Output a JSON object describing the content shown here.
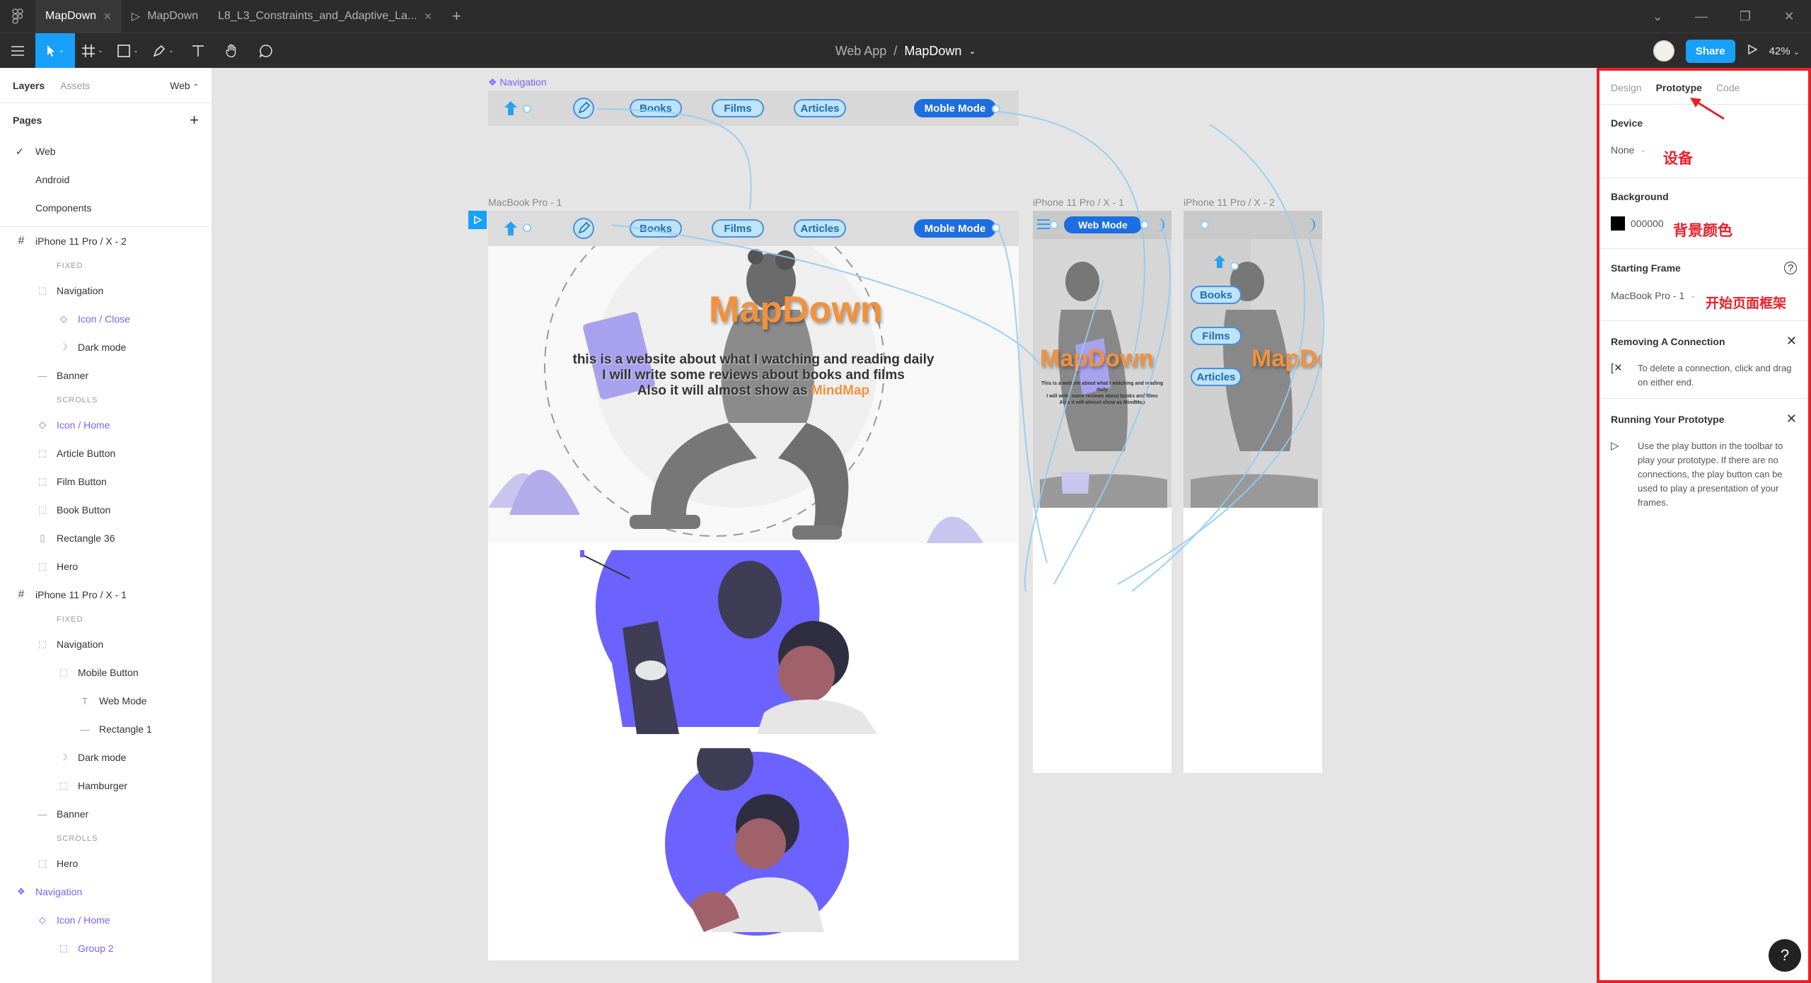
{
  "titlebar": {
    "tabs": [
      {
        "label": "MapDown",
        "active": true,
        "closable": true
      },
      {
        "label": "MapDown",
        "active": false,
        "play": true
      },
      {
        "label": "L8_L3_Constraints_and_Adaptive_La...",
        "active": false
      }
    ]
  },
  "toolbar": {
    "breadcrumb_parent": "Web App",
    "breadcrumb_sep": "/",
    "breadcrumb_current": "MapDown",
    "share_label": "Share",
    "zoom_label": "42%"
  },
  "left_panel": {
    "tab_layers": "Layers",
    "tab_assets": "Assets",
    "page_selector": "Web",
    "pages_heading": "Pages",
    "pages": [
      "Web",
      "Android",
      "Components"
    ],
    "layers": [
      {
        "label": "iPhone 11 Pro / X - 2",
        "kind": "frame",
        "indent": 0
      },
      {
        "label": "FIXED",
        "kind": "section",
        "indent": 1
      },
      {
        "label": "Navigation",
        "kind": "group",
        "indent": 1
      },
      {
        "label": "Icon / Close",
        "kind": "component",
        "indent": 2
      },
      {
        "label": "Dark mode",
        "kind": "moon",
        "indent": 2
      },
      {
        "label": "Banner",
        "kind": "line",
        "indent": 1
      },
      {
        "label": "SCROLLS",
        "kind": "section",
        "indent": 1
      },
      {
        "label": "Icon / Home",
        "kind": "component",
        "indent": 1
      },
      {
        "label": "Article Button",
        "kind": "group",
        "indent": 1
      },
      {
        "label": "Film Button",
        "kind": "group",
        "indent": 1
      },
      {
        "label": "Book Button",
        "kind": "group",
        "indent": 1
      },
      {
        "label": "Rectangle 36",
        "kind": "rect",
        "indent": 1
      },
      {
        "label": "Hero",
        "kind": "group",
        "indent": 1
      },
      {
        "label": "iPhone 11 Pro / X - 1",
        "kind": "frame",
        "indent": 0
      },
      {
        "label": "FIXED",
        "kind": "section",
        "indent": 1
      },
      {
        "label": "Navigation",
        "kind": "group",
        "indent": 1
      },
      {
        "label": "Mobile Button",
        "kind": "group",
        "indent": 2
      },
      {
        "label": "Web Mode",
        "kind": "text",
        "indent": 3
      },
      {
        "label": "Rectangle 1",
        "kind": "line",
        "indent": 3
      },
      {
        "label": "Dark mode",
        "kind": "moon",
        "indent": 2
      },
      {
        "label": "Hamburger",
        "kind": "group",
        "indent": 2
      },
      {
        "label": "Banner",
        "kind": "line",
        "indent": 1
      },
      {
        "label": "SCROLLS",
        "kind": "section",
        "indent": 1
      },
      {
        "label": "Hero",
        "kind": "group",
        "indent": 1
      },
      {
        "label": "Navigation",
        "kind": "component-main",
        "indent": 0
      },
      {
        "label": "Icon / Home",
        "kind": "component",
        "indent": 1
      },
      {
        "label": "Group 2",
        "kind": "group-purple",
        "indent": 2
      }
    ]
  },
  "canvas": {
    "nav_component_label": "Navigation",
    "macbook_label": "MacBook Pro - 1",
    "iphone1_label": "iPhone 11 Pro / X - 1",
    "iphone2_label": "iPhone 11 Pro / X - 2",
    "pill_books": "Books",
    "pill_films": "Films",
    "pill_articles": "Articles",
    "pill_mobile_mode": "Moble Mode",
    "pill_web_mode": "Web Mode",
    "hero_title": "MapDown",
    "hero_line1": "this is a website about what I watching and reading daily",
    "hero_line2": "I will write some reviews about books and films",
    "hero_line3_prefix": "Also it will almost show as ",
    "hero_line3_accent": "MindMap",
    "iphone_hero_title": "MapDown",
    "iphone_hero_small1": "This is a website about what I watching and reading daily",
    "iphone_hero_small2": "I will write some reviews about books and films",
    "iphone_hero_small3": "Also it will almost show as MindMap"
  },
  "right_panel": {
    "tab_design": "Design",
    "tab_prototype": "Prototype",
    "tab_code": "Code",
    "device_heading": "Device",
    "device_value": "None",
    "device_note": "设备",
    "background_heading": "Background",
    "background_hex": "000000",
    "background_note": "背景颜色",
    "starting_frame_heading": "Starting Frame",
    "starting_frame_value": "MacBook Pro - 1",
    "starting_frame_note": "开始页面框架",
    "removing_heading": "Removing A Connection",
    "removing_text": "To delete a connection, click and drag on either end.",
    "running_heading": "Running Your Prototype",
    "running_text": "Use the play button in the toolbar to play your prototype. If there are no connections, the play button can be used to play a presentation of your frames.",
    "help_label": "?"
  },
  "colors": {
    "accent_blue": "#18a0fb",
    "highlight_red": "#e8202a",
    "component_purple": "#7b61ff",
    "brand_orange": "#f2913d",
    "illustration_purple": "#6c63ff"
  }
}
